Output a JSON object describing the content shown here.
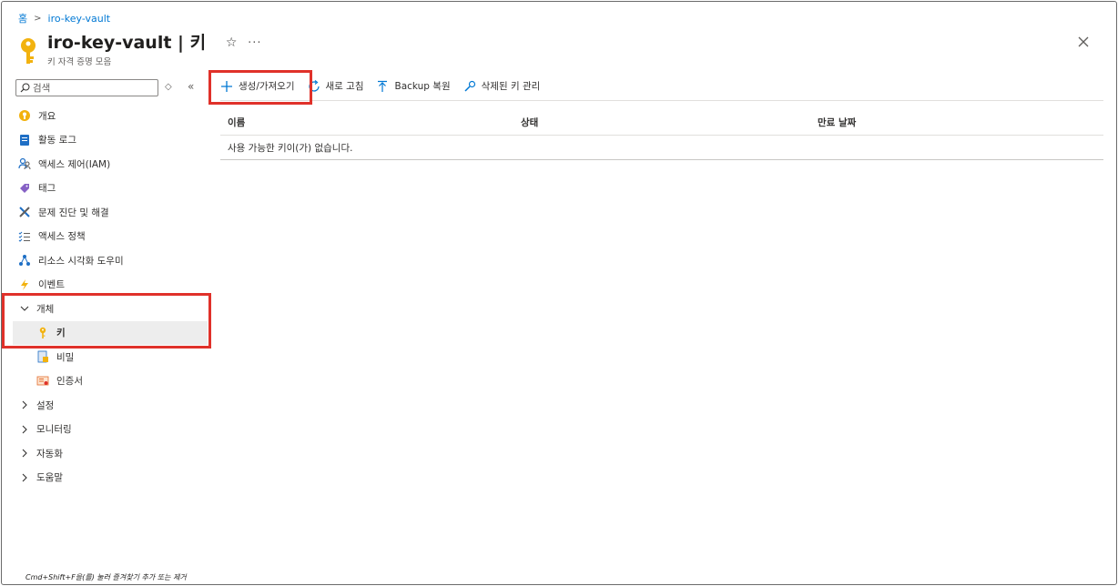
{
  "breadcrumb": {
    "home": "홈",
    "current": "iro-key-vault"
  },
  "header": {
    "title": "iro-key-vault | 키",
    "subtitle": "키 자격 증명 모음",
    "favorite_icon": "star-icon",
    "more_label": "···"
  },
  "sidebar": {
    "search_placeholder": "검색",
    "items": [
      {
        "label": "개요",
        "icon": "overview-icon"
      },
      {
        "label": "활동 로그",
        "icon": "activity-log-icon"
      },
      {
        "label": "액세스 제어(IAM)",
        "icon": "iam-icon"
      },
      {
        "label": "태그",
        "icon": "tag-icon"
      },
      {
        "label": "문제 진단 및 해결",
        "icon": "wrench-icon"
      },
      {
        "label": "액세스 정책",
        "icon": "policy-list-icon"
      },
      {
        "label": "리소스 시각화 도우미",
        "icon": "resource-visualizer-icon"
      },
      {
        "label": "이벤트",
        "icon": "lightning-icon"
      }
    ],
    "objects_group": {
      "label": "개체",
      "children": [
        {
          "label": "키",
          "icon": "key-icon",
          "selected": true
        },
        {
          "label": "비밀",
          "icon": "secret-icon"
        },
        {
          "label": "인증서",
          "icon": "certificate-icon"
        }
      ]
    },
    "collapsed_groups": [
      {
        "label": "설정"
      },
      {
        "label": "모니터링"
      },
      {
        "label": "자동화"
      },
      {
        "label": "도움말"
      }
    ]
  },
  "toolbar": {
    "create_import": "생성/가져오기",
    "refresh": "새로 고침",
    "backup_restore": "Backup 복원",
    "manage_deleted": "삭제된 키 관리"
  },
  "table": {
    "columns": [
      "이름",
      "상태",
      "만료 날짜"
    ],
    "empty_message": "사용 가능한 키이(가) 없습니다."
  },
  "footer": {
    "hint": "Cmd+Shift+F을(를) 눌러 즐겨찾기 추가 또는 제거"
  },
  "colors": {
    "accent": "#0078d4",
    "highlight": "#e0312a",
    "key_gold": "#f2b20f"
  }
}
